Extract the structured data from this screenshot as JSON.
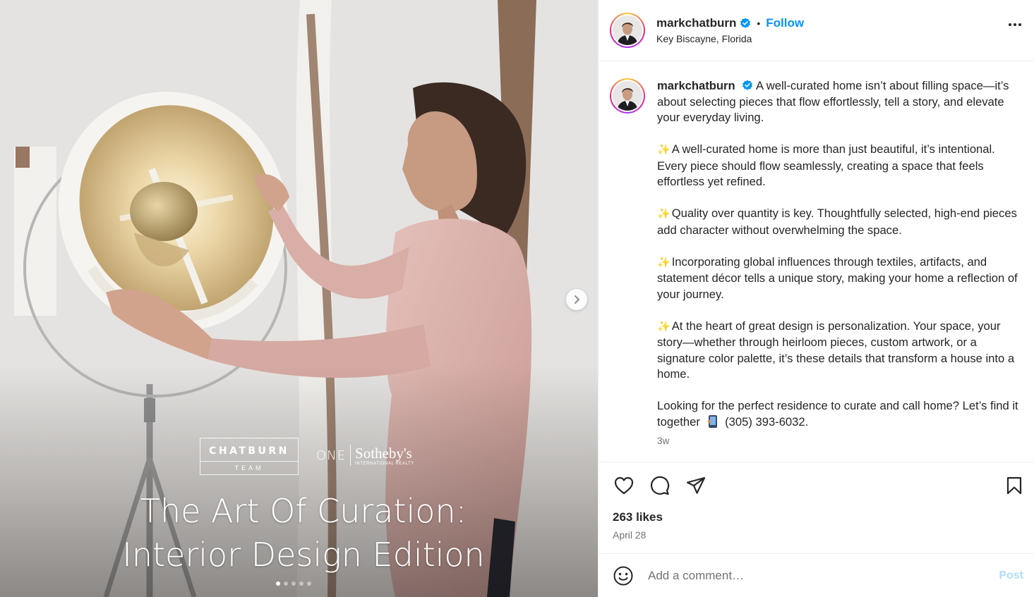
{
  "media": {
    "brand_name": "CHATBURN",
    "brand_sub": "TEAM",
    "partner_one": "ONE",
    "partner_name": "Sotheby's",
    "partner_sub": "INTERNATIONAL REALTY",
    "headline_line1": "The Art Of Curation:",
    "headline_line2": "Interior Design Edition",
    "slide_count": 5,
    "active_slide": 1,
    "next_icon": "chevron-right-icon"
  },
  "header": {
    "username": "markchatburn",
    "separator": "•",
    "follow_label": "Follow",
    "location": "Key Biscayne, Florida",
    "verified_icon": "verified-badge-icon",
    "more_icon": "more-options-icon"
  },
  "caption": {
    "username": "markchatburn",
    "intro": "A well-curated home isn’t about filling space—it’s about selecting pieces that flow effortlessly, tell a story, and elevate your everyday living.",
    "sparkle": "✨",
    "paragraph1": "A well-curated home is more than just beautiful, it’s intentional. Every piece should flow seamlessly, creating a space that feels effortless yet refined.",
    "paragraph2": "Quality over quantity is key. Thoughtfully selected, high-end pieces add character without overwhelming the space.",
    "paragraph3": "Incorporating global influences through textiles, artifacts, and statement décor tells a unique story, making your home a reflection of your journey.",
    "paragraph4": "At the heart of great design is personalization. Your space, your story—whether through heirloom pieces, custom artwork, or a signature color palette, it’s these details that transform a house into a home.",
    "closing_text": "Looking for the perfect residence to curate and call home? Let’s find it together",
    "phone_icon": "mobile-phone-emoji",
    "phone": "(305) 393-6032.",
    "time_ago": "3w"
  },
  "actions": {
    "like_icon": "heart-icon",
    "comment_icon": "comment-icon",
    "share_icon": "share-icon",
    "save_icon": "bookmark-icon",
    "likes": "263 likes",
    "date": "April 28"
  },
  "comment": {
    "emoji_icon": "emoji-icon",
    "placeholder": "Add a comment…",
    "post_label": "Post"
  },
  "colors": {
    "link_blue": "#0095f6",
    "post_disabled": "#b3dbff",
    "verified_blue": "#0095f6",
    "text_primary": "#262626",
    "text_secondary": "#737373"
  }
}
